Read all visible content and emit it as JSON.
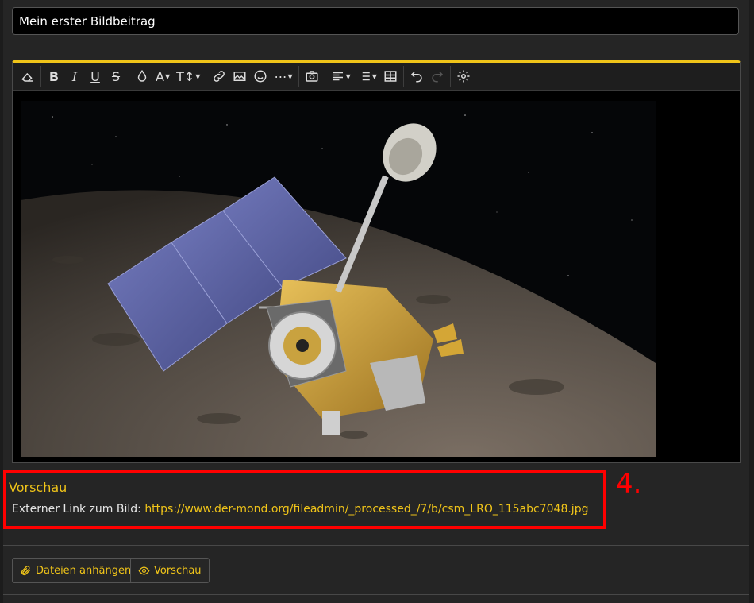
{
  "post": {
    "title_value": "Mein erster Bildbeitrag"
  },
  "toolbar": {
    "buttons": [
      "clear-formatting",
      "bold",
      "italic",
      "underline",
      "strikethrough",
      "color",
      "font-family",
      "font-size",
      "link",
      "image",
      "emoji",
      "more",
      "insert-media",
      "align",
      "list",
      "table",
      "undo",
      "redo",
      "settings"
    ],
    "bold_label": "B",
    "italic_label": "I",
    "underline_label": "U",
    "strike_label": "S",
    "font_label": "A",
    "size_label": "T↕"
  },
  "preview": {
    "title": "Vorschau",
    "link_prefix": "Externer Link zum Bild:",
    "link_url": "https://www.der-mond.org/fileadmin/_processed_/7/b/csm_LRO_115abc7048.jpg",
    "step_label": "4."
  },
  "buttons": {
    "attach": "Dateien anhängen",
    "preview": "Vorschau"
  },
  "colors": {
    "accent": "#f0c419",
    "highlight": "#ff0000",
    "background": "#252525"
  }
}
